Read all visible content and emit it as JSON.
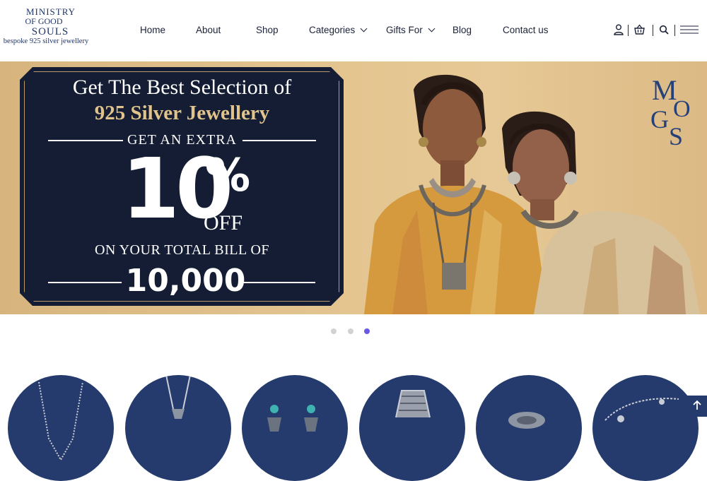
{
  "brand": {
    "line1": "MINISTRY",
    "line2": "OF GOOD",
    "line3": "SOULS",
    "tagline": "bespoke 925 silver jewellery"
  },
  "nav": {
    "items": [
      {
        "label": "Home"
      },
      {
        "label": "About"
      },
      {
        "label": "Shop"
      },
      {
        "label": "Categories"
      },
      {
        "label": "Gifts For"
      },
      {
        "label": "Blog"
      },
      {
        "label": "Contact us"
      }
    ]
  },
  "header_icons": [
    "user-icon",
    "basket-icon",
    "search-icon",
    "menu-icon"
  ],
  "banner": {
    "headline": "Get The Best Selection of",
    "subheadline": "925 Silver Jewellery",
    "extra": "GET AN EXTRA",
    "discount": "10",
    "percent": "%",
    "off": "OFF",
    "condition": "ON YOUR TOTAL BILL OF",
    "amount": "10,000",
    "monogram": "MOGS"
  },
  "carousel": {
    "slides": 3,
    "active_index": 3
  },
  "categories": [
    {
      "icon": "necklace-icon"
    },
    {
      "icon": "pendant-icon"
    },
    {
      "icon": "earrings-icon"
    },
    {
      "icon": "bangle-icon"
    },
    {
      "icon": "ring-icon"
    },
    {
      "icon": "anklet-icon"
    }
  ],
  "colors": {
    "navy": "#253b6e",
    "offer_bg": "#141d33",
    "gold_text": "#e0c48b",
    "active_dot": "#6b57e6"
  }
}
